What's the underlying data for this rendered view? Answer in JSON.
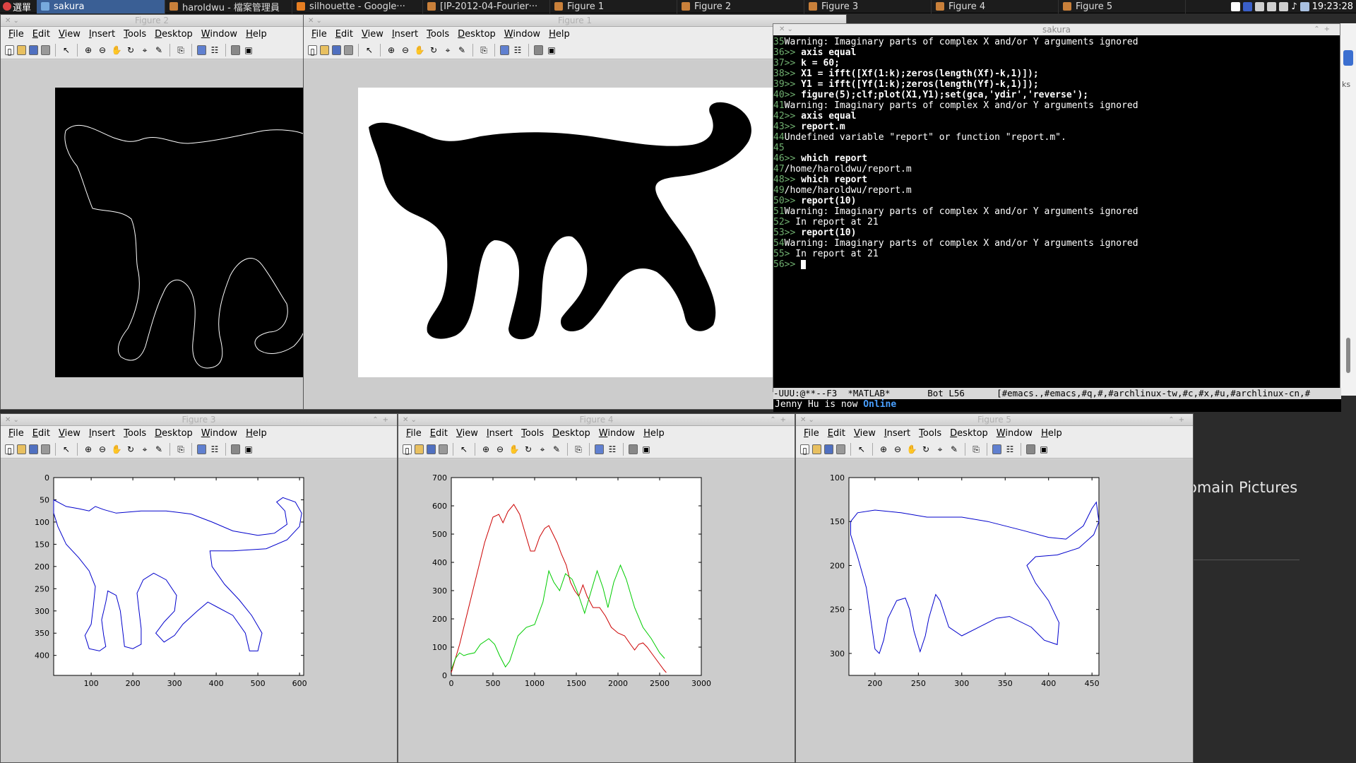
{
  "taskbar": {
    "start_label": "選單",
    "tasks": [
      {
        "label": "sakura",
        "active": true
      },
      {
        "label": "haroldwu - 檔案管理員",
        "active": false
      },
      {
        "label": "silhouette - Google···",
        "active": false
      },
      {
        "label": "[IP-2012-04-Fourier···",
        "active": false
      },
      {
        "label": "Figure 1",
        "active": false
      },
      {
        "label": "Figure 2",
        "active": false
      },
      {
        "label": "Figure 3",
        "active": false
      },
      {
        "label": "Figure 4",
        "active": false
      },
      {
        "label": "Figure 5",
        "active": false
      }
    ],
    "clock": "19:23:28"
  },
  "menu": {
    "file": "File",
    "edit": "Edit",
    "view": "View",
    "insert": "Insert",
    "tools": "Tools",
    "desktop": "Desktop",
    "window": "Window",
    "help": "Help"
  },
  "figures": {
    "fig1": {
      "title": "Figure 1"
    },
    "fig2": {
      "title": "Figure 2"
    },
    "fig3": {
      "title": "Figure 3"
    },
    "fig4": {
      "title": "Figure 4"
    },
    "fig5": {
      "title": "Figure 5"
    }
  },
  "terminal": {
    "title": "sakura",
    "lines": [
      {
        "n": "35",
        "text": "Warning: Imaginary parts of complex X and/or Y arguments ignored",
        "prompt": false
      },
      {
        "n": "36",
        "text": " axis equal",
        "prompt": true
      },
      {
        "n": "37",
        "text": " k = 60;",
        "prompt": true
      },
      {
        "n": "38",
        "text": " X1 = ifft([Xf(1:k);zeros(length(Xf)-k,1)]);",
        "prompt": true
      },
      {
        "n": "39",
        "text": " Y1 = ifft([Yf(1:k);zeros(length(Yf)-k,1)]);",
        "prompt": true
      },
      {
        "n": "40",
        "text": " figure(5);clf;plot(X1,Y1);set(gca,'ydir','reverse');",
        "prompt": true
      },
      {
        "n": "41",
        "text": "Warning: Imaginary parts of complex X and/or Y arguments ignored",
        "prompt": false
      },
      {
        "n": "42",
        "text": " axis equal",
        "prompt": true
      },
      {
        "n": "43",
        "text": " report.m",
        "prompt": true
      },
      {
        "n": "44",
        "text": "Undefined variable \"report\" or function \"report.m\".",
        "prompt": false
      },
      {
        "n": "45",
        "text": "",
        "prompt": false
      },
      {
        "n": "46",
        "text": " which report",
        "prompt": true
      },
      {
        "n": "47",
        "text": "/home/haroldwu/report.m",
        "prompt": false
      },
      {
        "n": "48",
        "text": " which report",
        "prompt": true
      },
      {
        "n": "49",
        "text": "/home/haroldwu/report.m",
        "prompt": false
      },
      {
        "n": "50",
        "text": " report(10)",
        "prompt": true
      },
      {
        "n": "51",
        "text": "Warning: Imaginary parts of complex X and/or Y arguments ignored",
        "prompt": false
      },
      {
        "n": "52",
        "text": " In report at 21",
        "prompt": "gt"
      },
      {
        "n": "53",
        "text": " report(10)",
        "prompt": true
      },
      {
        "n": "54",
        "text": "Warning: Imaginary parts of complex X and/or Y arguments ignored",
        "prompt": false
      },
      {
        "n": "55",
        "text": " In report at 21",
        "prompt": "gt"
      },
      {
        "n": "56",
        "text": " ",
        "prompt": true
      }
    ],
    "modeline": "-UUU:@**--F3  *MATLAB*       Bot L56      [#emacs.,#emacs,#q,#,#archlinux-tw,#c,#x,#u,#archlinux-cn,#",
    "minibuffer_prefix": "Jenny Hu is now ",
    "minibuffer_status": "Online"
  },
  "background": {
    "text": "omain Pictures"
  },
  "chart_data": [
    {
      "figure": "Figure 3",
      "type": "line",
      "title": "",
      "xlabel": "",
      "ylabel": "",
      "xlim": [
        10,
        610
      ],
      "ylim": [
        0,
        445
      ],
      "y_reversed": true,
      "xticks": [
        100,
        200,
        300,
        400,
        500,
        600
      ],
      "yticks": [
        0,
        50,
        100,
        150,
        200,
        250,
        300,
        350,
        400
      ],
      "series": [
        {
          "color": "#0000cc",
          "points": [
            [
              10,
              50
            ],
            [
              40,
              65
            ],
            [
              70,
              70
            ],
            [
              95,
              75
            ],
            [
              110,
              65
            ],
            [
              130,
              72
            ],
            [
              160,
              80
            ],
            [
              220,
              75
            ],
            [
              280,
              75
            ],
            [
              340,
              82
            ],
            [
              390,
              100
            ],
            [
              440,
              120
            ],
            [
              500,
              130
            ],
            [
              540,
              125
            ],
            [
              570,
              105
            ],
            [
              565,
              75
            ],
            [
              545,
              55
            ],
            [
              560,
              45
            ],
            [
              590,
              55
            ],
            [
              605,
              80
            ],
            [
              600,
              110
            ],
            [
              570,
              140
            ],
            [
              520,
              160
            ],
            [
              440,
              165
            ],
            [
              385,
              165
            ],
            [
              390,
              200
            ],
            [
              420,
              240
            ],
            [
              455,
              275
            ],
            [
              485,
              310
            ],
            [
              510,
              350
            ],
            [
              500,
              390
            ],
            [
              480,
              390
            ],
            [
              470,
              350
            ],
            [
              440,
              310
            ],
            [
              400,
              290
            ],
            [
              380,
              280
            ],
            [
              355,
              300
            ],
            [
              320,
              330
            ],
            [
              300,
              355
            ],
            [
              275,
              370
            ],
            [
              255,
              350
            ],
            [
              275,
              325
            ],
            [
              300,
              300
            ],
            [
              305,
              265
            ],
            [
              280,
              230
            ],
            [
              250,
              215
            ],
            [
              225,
              230
            ],
            [
              210,
              260
            ],
            [
              215,
              300
            ],
            [
              220,
              340
            ],
            [
              220,
              375
            ],
            [
              200,
              385
            ],
            [
              180,
              380
            ],
            [
              175,
              340
            ],
            [
              170,
              300
            ],
            [
              160,
              265
            ],
            [
              140,
              255
            ],
            [
              135,
              280
            ],
            [
              125,
              320
            ],
            [
              130,
              355
            ],
            [
              135,
              380
            ],
            [
              120,
              390
            ],
            [
              95,
              385
            ],
            [
              85,
              355
            ],
            [
              100,
              330
            ],
            [
              105,
              290
            ],
            [
              110,
              245
            ],
            [
              95,
              210
            ],
            [
              70,
              180
            ],
            [
              40,
              150
            ],
            [
              20,
              110
            ],
            [
              10,
              80
            ],
            [
              10,
              50
            ]
          ]
        }
      ]
    },
    {
      "figure": "Figure 4",
      "type": "line",
      "title": "",
      "xlabel": "",
      "ylabel": "",
      "xlim": [
        0,
        3000
      ],
      "ylim": [
        0,
        700
      ],
      "xticks": [
        0,
        500,
        1000,
        1500,
        2000,
        2500,
        3000
      ],
      "yticks": [
        0,
        100,
        200,
        300,
        400,
        500,
        600,
        700
      ],
      "series": [
        {
          "color": "#cc0000",
          "points": [
            [
              0,
              10
            ],
            [
              100,
              110
            ],
            [
              200,
              230
            ],
            [
              300,
              350
            ],
            [
              400,
              470
            ],
            [
              500,
              560
            ],
            [
              570,
              570
            ],
            [
              620,
              540
            ],
            [
              680,
              580
            ],
            [
              750,
              605
            ],
            [
              820,
              570
            ],
            [
              900,
              490
            ],
            [
              950,
              440
            ],
            [
              1000,
              440
            ],
            [
              1060,
              490
            ],
            [
              1120,
              520
            ],
            [
              1170,
              530
            ],
            [
              1220,
              500
            ],
            [
              1270,
              470
            ],
            [
              1320,
              430
            ],
            [
              1380,
              390
            ],
            [
              1430,
              330
            ],
            [
              1480,
              300
            ],
            [
              1530,
              280
            ],
            [
              1580,
              320
            ],
            [
              1630,
              280
            ],
            [
              1700,
              240
            ],
            [
              1780,
              240
            ],
            [
              1850,
              210
            ],
            [
              1920,
              170
            ],
            [
              2000,
              150
            ],
            [
              2080,
              140
            ],
            [
              2150,
              110
            ],
            [
              2200,
              90
            ],
            [
              2250,
              110
            ],
            [
              2300,
              115
            ],
            [
              2350,
              100
            ],
            [
              2400,
              80
            ],
            [
              2450,
              60
            ],
            [
              2500,
              40
            ],
            [
              2550,
              20
            ],
            [
              2580,
              10
            ]
          ]
        },
        {
          "color": "#00cc00",
          "points": [
            [
              0,
              20
            ],
            [
              50,
              60
            ],
            [
              100,
              80
            ],
            [
              150,
              70
            ],
            [
              200,
              75
            ],
            [
              280,
              80
            ],
            [
              350,
              110
            ],
            [
              450,
              130
            ],
            [
              520,
              110
            ],
            [
              580,
              70
            ],
            [
              650,
              30
            ],
            [
              700,
              50
            ],
            [
              800,
              140
            ],
            [
              900,
              170
            ],
            [
              1000,
              180
            ],
            [
              1100,
              260
            ],
            [
              1170,
              370
            ],
            [
              1230,
              330
            ],
            [
              1300,
              300
            ],
            [
              1370,
              360
            ],
            [
              1450,
              340
            ],
            [
              1520,
              290
            ],
            [
              1600,
              220
            ],
            [
              1680,
              300
            ],
            [
              1750,
              370
            ],
            [
              1820,
              310
            ],
            [
              1880,
              240
            ],
            [
              1950,
              330
            ],
            [
              2030,
              390
            ],
            [
              2100,
              340
            ],
            [
              2200,
              240
            ],
            [
              2300,
              170
            ],
            [
              2400,
              130
            ],
            [
              2500,
              80
            ],
            [
              2560,
              60
            ]
          ]
        }
      ]
    },
    {
      "figure": "Figure 5",
      "type": "line",
      "title": "",
      "xlabel": "",
      "ylabel": "",
      "xlim": [
        170,
        458
      ],
      "ylim": [
        100,
        325
      ],
      "y_reversed": true,
      "xticks": [
        200,
        250,
        300,
        350,
        400,
        450
      ],
      "yticks": [
        100,
        150,
        200,
        250,
        300
      ],
      "series": [
        {
          "color": "#0000cc",
          "points": [
            [
              172,
              150
            ],
            [
              180,
              140
            ],
            [
              200,
              137
            ],
            [
              230,
              140
            ],
            [
              260,
              145
            ],
            [
              300,
              145
            ],
            [
              330,
              150
            ],
            [
              370,
              160
            ],
            [
              400,
              168
            ],
            [
              420,
              170
            ],
            [
              440,
              155
            ],
            [
              450,
              135
            ],
            [
              455,
              128
            ],
            [
              458,
              150
            ],
            [
              452,
              165
            ],
            [
              435,
              180
            ],
            [
              410,
              188
            ],
            [
              385,
              190
            ],
            [
              375,
              200
            ],
            [
              385,
              220
            ],
            [
              400,
              240
            ],
            [
              412,
              265
            ],
            [
              410,
              290
            ],
            [
              395,
              285
            ],
            [
              380,
              270
            ],
            [
              355,
              258
            ],
            [
              340,
              260
            ],
            [
              320,
              270
            ],
            [
              300,
              280
            ],
            [
              285,
              270
            ],
            [
              275,
              240
            ],
            [
              270,
              233
            ],
            [
              262,
              260
            ],
            [
              258,
              280
            ],
            [
              252,
              298
            ],
            [
              245,
              275
            ],
            [
              240,
              250
            ],
            [
              235,
              237
            ],
            [
              225,
              240
            ],
            [
              215,
              260
            ],
            [
              210,
              285
            ],
            [
              205,
              300
            ],
            [
              200,
              295
            ],
            [
              195,
              260
            ],
            [
              190,
              225
            ],
            [
              180,
              190
            ],
            [
              172,
              165
            ],
            [
              172,
              150
            ]
          ]
        }
      ]
    }
  ]
}
